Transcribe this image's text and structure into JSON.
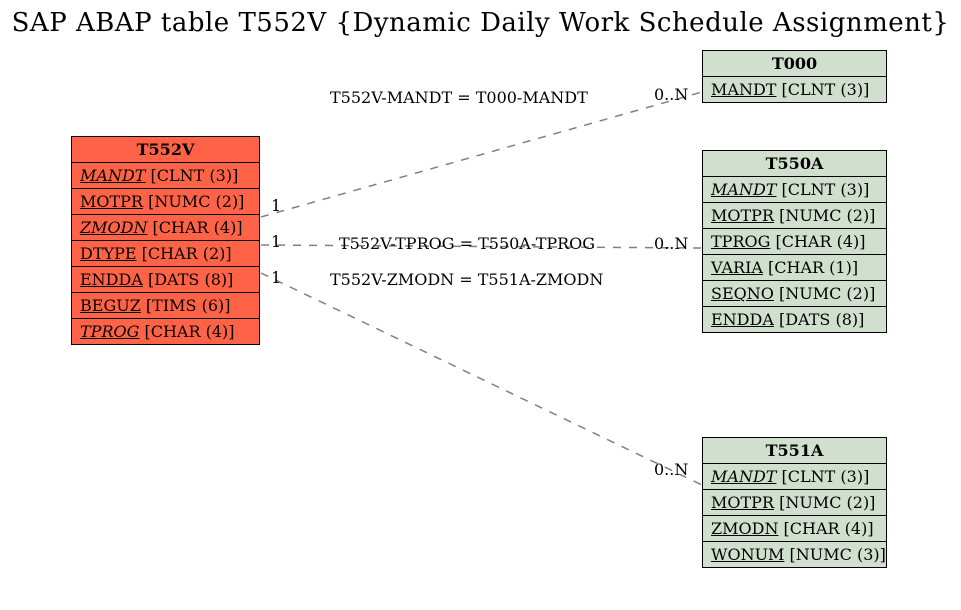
{
  "title": "SAP ABAP table T552V {Dynamic Daily Work Schedule Assignment}",
  "tables": {
    "t552v": {
      "name": "T552V",
      "fields": [
        {
          "name": "MANDT",
          "type": "[CLNT (3)]",
          "key": true
        },
        {
          "name": "MOTPR",
          "type": "[NUMC (2)]",
          "key": false
        },
        {
          "name": "ZMODN",
          "type": "[CHAR (4)]",
          "key": true
        },
        {
          "name": "DTYPE",
          "type": "[CHAR (2)]",
          "key": false
        },
        {
          "name": "ENDDA",
          "type": "[DATS (8)]",
          "key": false
        },
        {
          "name": "BEGUZ",
          "type": "[TIMS (6)]",
          "key": false
        },
        {
          "name": "TPROG",
          "type": "[CHAR (4)]",
          "key": true
        }
      ]
    },
    "t000": {
      "name": "T000",
      "fields": [
        {
          "name": "MANDT",
          "type": "[CLNT (3)]",
          "key": false
        }
      ]
    },
    "t550a": {
      "name": "T550A",
      "fields": [
        {
          "name": "MANDT",
          "type": "[CLNT (3)]",
          "key": true
        },
        {
          "name": "MOTPR",
          "type": "[NUMC (2)]",
          "key": false
        },
        {
          "name": "TPROG",
          "type": "[CHAR (4)]",
          "key": false
        },
        {
          "name": "VARIA",
          "type": "[CHAR (1)]",
          "key": false
        },
        {
          "name": "SEQNO",
          "type": "[NUMC (2)]",
          "key": false
        },
        {
          "name": "ENDDA",
          "type": "[DATS (8)]",
          "key": false
        }
      ]
    },
    "t551a": {
      "name": "T551A",
      "fields": [
        {
          "name": "MANDT",
          "type": "[CLNT (3)]",
          "key": true
        },
        {
          "name": "MOTPR",
          "type": "[NUMC (2)]",
          "key": false
        },
        {
          "name": "ZMODN",
          "type": "[CHAR (4)]",
          "key": false
        },
        {
          "name": "WONUM",
          "type": "[NUMC (3)]",
          "key": false
        }
      ]
    }
  },
  "relations": {
    "r1": {
      "label": "T552V-MANDT = T000-MANDT",
      "left": "1",
      "right": "0..N"
    },
    "r2": {
      "label": "T552V-TPROG = T550A-TPROG",
      "left": "1",
      "right": "0..N"
    },
    "r3": {
      "label": "T552V-ZMODN = T551A-ZMODN",
      "left": "1",
      "right": "0..N"
    }
  }
}
